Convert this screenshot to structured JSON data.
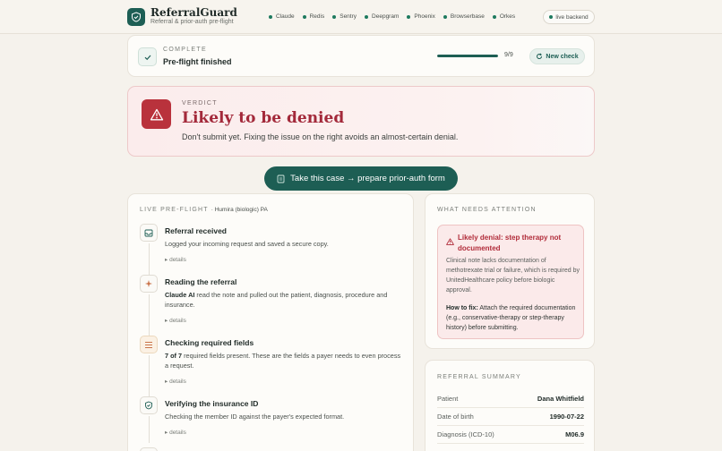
{
  "header": {
    "brand_name": "ReferralGuard",
    "brand_tagline": "Referral & prior-auth pre-flight",
    "services": [
      "Claude",
      "Redis",
      "Sentry",
      "Deepgram",
      "Phoenix",
      "Browserbase",
      "Orkes"
    ],
    "backend_status": "live backend",
    "accent_color": "#1d5e54"
  },
  "status": {
    "label": "COMPLETE",
    "title": "Pre-flight finished",
    "progress_text": "9/9",
    "progress_fraction": 1.0,
    "new_check_label": "New check"
  },
  "verdict": {
    "label": "VERDICT",
    "title": "Likely to be denied",
    "subtitle": "Don't submit yet. Fixing the issue on the right avoids an almost-certain denial.",
    "color": "#b9323c"
  },
  "cta": {
    "label": "Take this case → prepare prior-auth form"
  },
  "pipeline": {
    "header": "LIVE PRE-FLIGHT",
    "context": "· Humira (biologic) PA",
    "details_label": "details",
    "steps": [
      {
        "title": "Referral received",
        "desc": "Logged your incoming request and saved a secure copy.",
        "icon": "inbox-icon"
      },
      {
        "title": "Reading the referral",
        "desc_bold": "Claude AI",
        "desc": " read the note and pulled out the patient, diagnosis, procedure and insurance.",
        "icon": "sparkle-icon"
      },
      {
        "title": "Checking required fields",
        "desc_bold": "7 of 7",
        "desc": " required fields present. These are the fields a payer needs to even process a request.",
        "icon": "list-icon"
      },
      {
        "title": "Verifying the insurance ID",
        "desc": "Checking the member ID against the payer's expected format.",
        "icon": "shield-check-icon"
      }
    ]
  },
  "attention": {
    "label": "WHAT NEEDS ATTENTION",
    "alert_title": "Likely denial: step therapy not documented",
    "alert_body": "Clinical note lacks documentation of methotrexate trial or failure, which is required by UnitedHealthcare policy before biologic approval.",
    "fix_label": "How to fix:",
    "fix_text": " Attach the required documentation (e.g., conservative-therapy or step-therapy history) before submitting."
  },
  "summary": {
    "label": "REFERRAL SUMMARY",
    "rows": [
      {
        "key": "Patient",
        "value": "Dana Whitfield"
      },
      {
        "key": "Date of birth",
        "value": "1990-07-22"
      },
      {
        "key": "Diagnosis (ICD-10)",
        "value": "M06.9"
      }
    ]
  }
}
